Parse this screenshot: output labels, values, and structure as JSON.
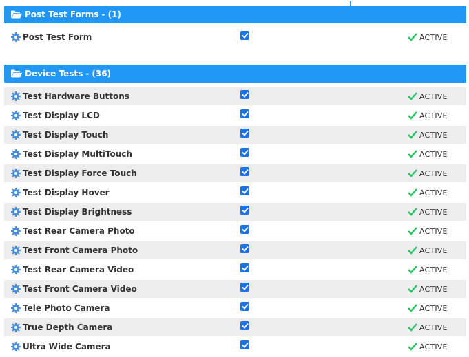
{
  "sections": [
    {
      "title": "Post Test Forms",
      "count": "- (1)",
      "items": [
        {
          "label": "Post Test Form",
          "checked": true,
          "status": "ACTIVE"
        }
      ]
    },
    {
      "title": "Device Tests",
      "count": "- (36)",
      "items": [
        {
          "label": "Test Hardware Buttons",
          "checked": true,
          "status": "ACTIVE"
        },
        {
          "label": "Test Display LCD",
          "checked": true,
          "status": "ACTIVE"
        },
        {
          "label": "Test Display Touch",
          "checked": true,
          "status": "ACTIVE"
        },
        {
          "label": "Test Display MultiTouch",
          "checked": true,
          "status": "ACTIVE"
        },
        {
          "label": "Test Display Force Touch",
          "checked": true,
          "status": "ACTIVE"
        },
        {
          "label": "Test Display Hover",
          "checked": true,
          "status": "ACTIVE"
        },
        {
          "label": "Test Display Brightness",
          "checked": true,
          "status": "ACTIVE"
        },
        {
          "label": "Test Rear Camera Photo",
          "checked": true,
          "status": "ACTIVE"
        },
        {
          "label": "Test Front Camera Photo",
          "checked": true,
          "status": "ACTIVE"
        },
        {
          "label": "Test Rear Camera Video",
          "checked": true,
          "status": "ACTIVE"
        },
        {
          "label": "Test Front Camera Video",
          "checked": true,
          "status": "ACTIVE"
        },
        {
          "label": "Tele Photo Camera",
          "checked": true,
          "status": "ACTIVE"
        },
        {
          "label": "True Depth Camera",
          "checked": true,
          "status": "ACTIVE"
        },
        {
          "label": "Ultra Wide Camera",
          "checked": true,
          "status": "ACTIVE"
        }
      ]
    }
  ],
  "colors": {
    "header": "#2196f3",
    "check": "#1a73e8",
    "status_tick": "#22c55e",
    "gear": "#4a90e2"
  },
  "icons": {
    "section": "folder-open-icon",
    "row": "gear-icon",
    "status": "checkmark-icon"
  }
}
